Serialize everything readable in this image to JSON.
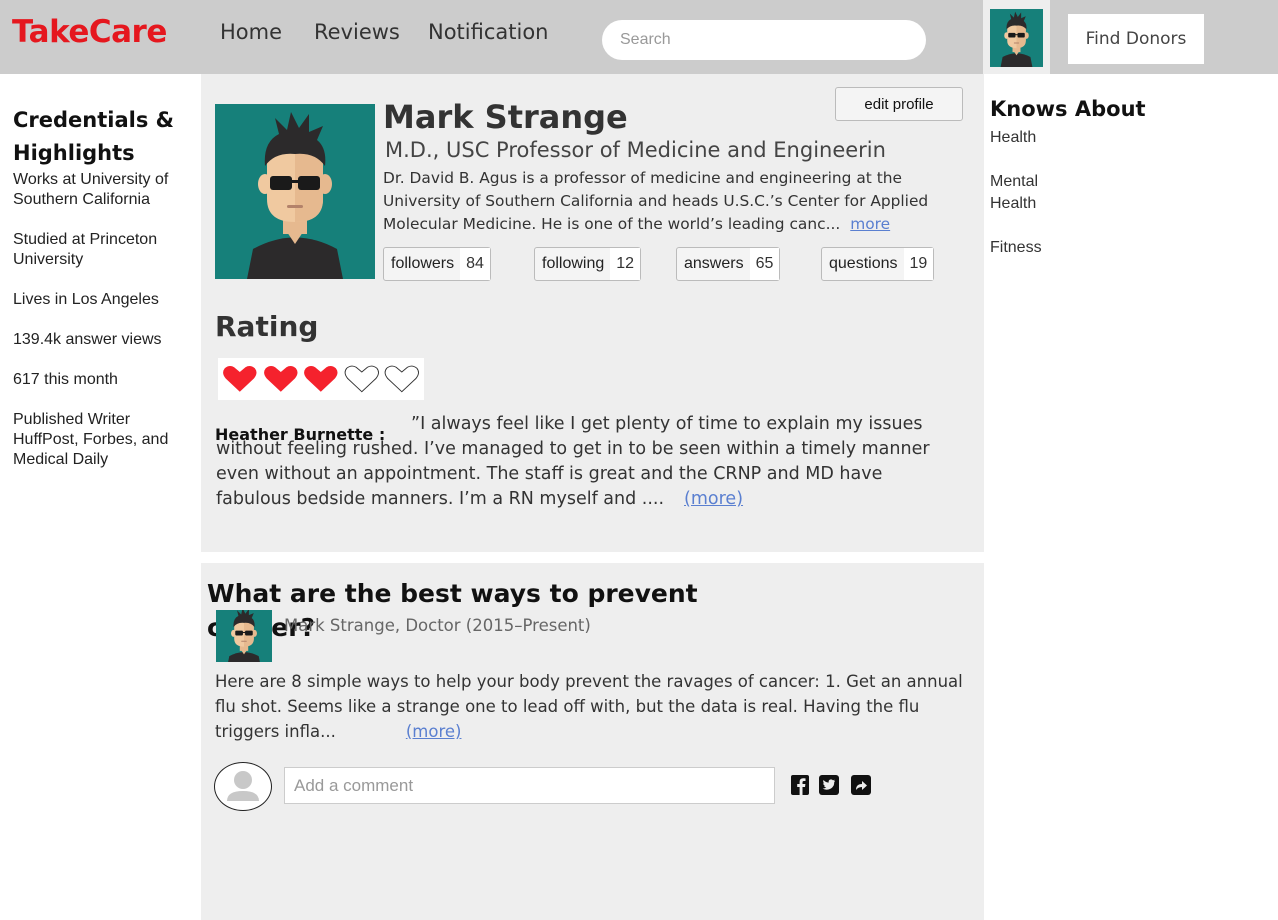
{
  "header": {
    "logo": "TakeCare",
    "nav": [
      "Home",
      "Reviews",
      "Notification"
    ],
    "search_placeholder": "Search",
    "find_donors": "Find Donors"
  },
  "credentials": {
    "title": "Credentials & Highlights",
    "items": [
      "Works at University of Southern California",
      "Studied at Princeton University",
      "Lives in Los Angeles",
      "139.4k answer views",
      "617 this month",
      "Published Writer HuffPost, Forbes, and Medical Daily"
    ]
  },
  "profile": {
    "name": "Mark Strange",
    "credential": "M.D., USC Professor of Medicine and Engineering",
    "bio": "Dr. David B. Agus is a professor of medicine and engineering at the University of Southern California and heads U.S.C.’s Center for Applied Molecular Medicine. He is one of the world’s leading canc...",
    "more": "more",
    "edit_label": "edit profile",
    "stats": [
      {
        "label": "followers",
        "count": "84"
      },
      {
        "label": "following",
        "count": "12"
      },
      {
        "label": "answers",
        "count": "65"
      },
      {
        "label": "questions",
        "count": "19"
      }
    ]
  },
  "rating": {
    "title": "Rating",
    "filled": 3,
    "total": 5,
    "heart_color": "#f5222d",
    "reviewer": "Heather Burnette :",
    "text": "”I always feel like I get plenty of time to explain my issues without feeling rushed. I’ve managed to get in to be seen within a timely manner even without an appointment. The staff is great and the CRNP and MD have fabulous bedside manners. I’m a RN myself and ....",
    "more": "(more)"
  },
  "question": {
    "title": "What are the best ways to prevent cancer?",
    "author": "Mark Strange, Doctor (2015–Present)",
    "text": "Here are 8 simple ways to help your body prevent the ravages of cancer: 1.  Get an annual flu shot. Seems like a strange one to lead off with, but the data is real.  Having the flu triggers infla...",
    "more": "(more)",
    "comment_placeholder": "Add a comment",
    "share_icons": [
      "facebook-icon",
      "twitter-icon",
      "share-icon"
    ]
  },
  "knows_about": {
    "title": "Knows About",
    "topics": [
      "Health",
      "Mental Health",
      "Fitness"
    ]
  },
  "colors": {
    "brand": "#e5171e",
    "avatar_bg": "#16807a",
    "link": "#5a7fd0"
  }
}
